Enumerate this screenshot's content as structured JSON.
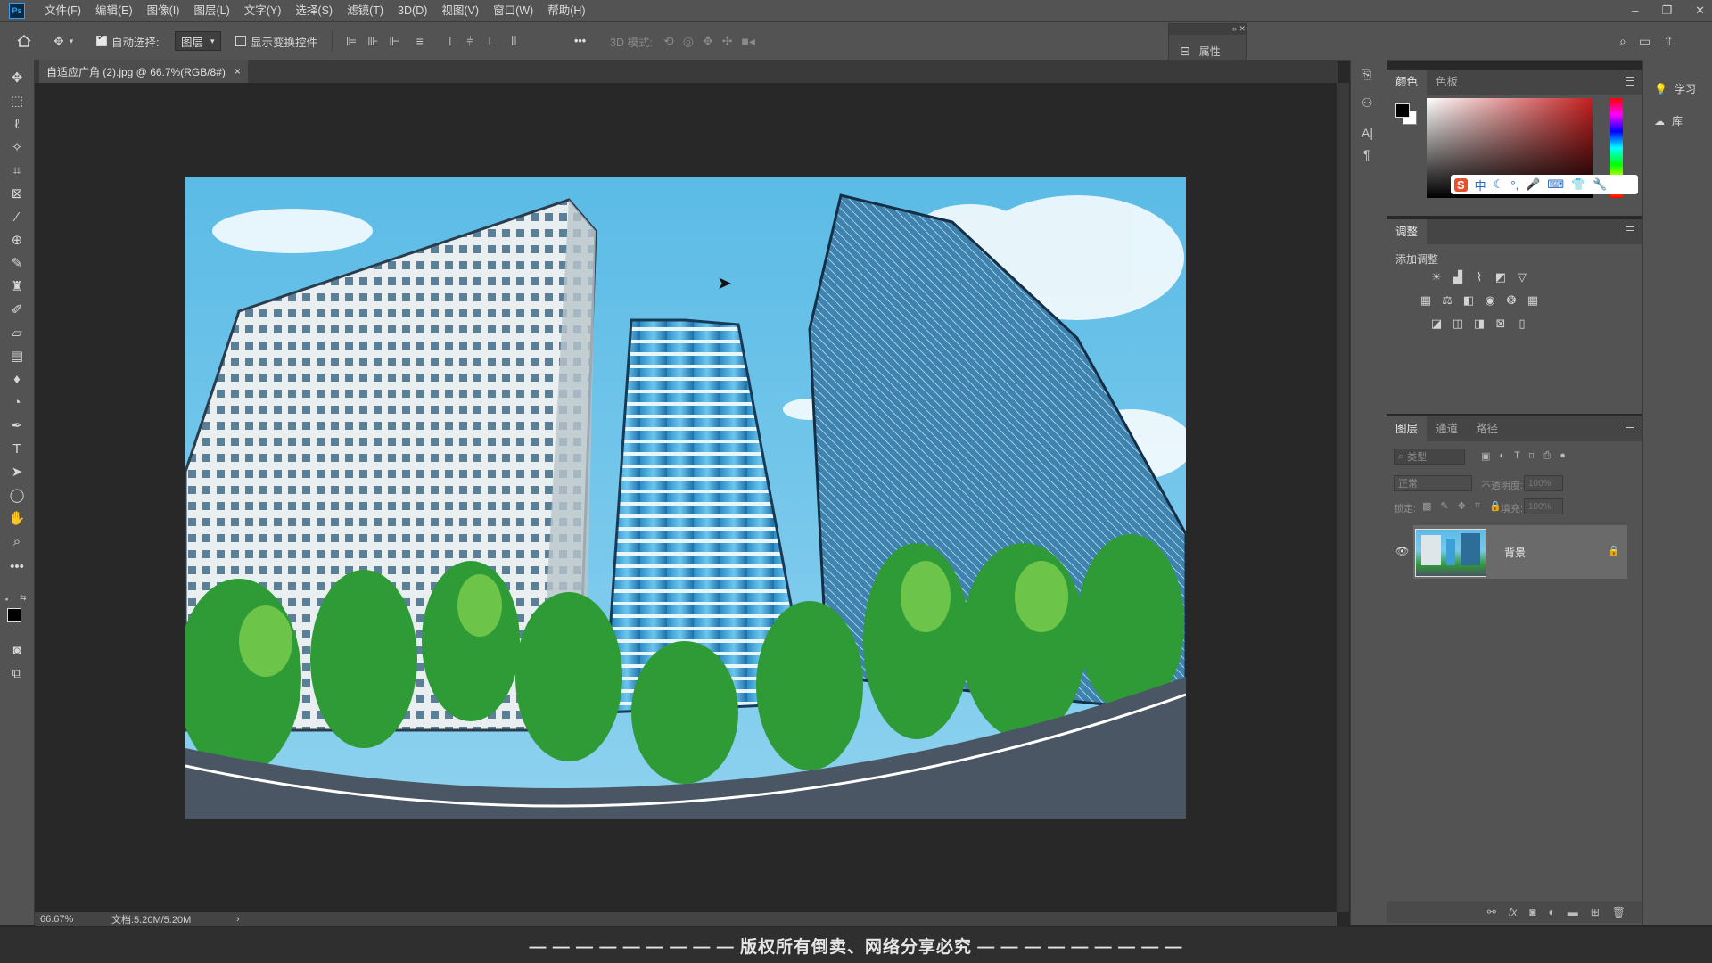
{
  "app": {
    "logo": "Ps"
  },
  "menu": [
    "文件(F)",
    "编辑(E)",
    "图像(I)",
    "图层(L)",
    "文字(Y)",
    "选择(S)",
    "滤镜(T)",
    "3D(D)",
    "视图(V)",
    "窗口(W)",
    "帮助(H)"
  ],
  "window_controls": {
    "minimize": "–",
    "restore": "❐",
    "close": "✕"
  },
  "options": {
    "auto_select_label": "自动选择:",
    "auto_select_checked": true,
    "layer_mode": "图层",
    "show_transform_label": "显示变换控件",
    "show_transform_checked": false,
    "mode_3d_label": "3D 模式:",
    "more": "•••"
  },
  "properties_panel": {
    "label": "属性"
  },
  "document_tab": {
    "title": "自适应广角 (2).jpg @ 66.7%(RGB/8#)",
    "close": "×"
  },
  "status": {
    "zoom": "66.67%",
    "doc_size": "文档:5.20M/5.20M",
    "arrow": "›"
  },
  "color_panel": {
    "tabs": [
      "颜色",
      "色板"
    ],
    "active": 0,
    "hue_color": "#c41f1f"
  },
  "ime_bar": {
    "items": [
      "S",
      "中",
      "☾",
      "°,",
      "🎤",
      "⌨",
      "👕",
      "🔧"
    ]
  },
  "adjustments_panel": {
    "title": "调整",
    "add_label": "添加调整"
  },
  "layers_panel": {
    "tabs": [
      "图层",
      "通道",
      "路径"
    ],
    "active": 0,
    "filter_placeholder": "类型",
    "blend_mode": "正常",
    "opacity_label": "不透明度:",
    "opacity_value": "100%",
    "lock_label": "锁定:",
    "fill_label": "填充:",
    "fill_value": "100%",
    "layers": [
      {
        "name": "背景",
        "visible": true,
        "locked": true
      }
    ]
  },
  "right_strip": {
    "learn_label": "学习",
    "libraries_label": "库"
  },
  "watermark": "— — — — — — — — — 版权所有倒卖、网络分享必究 — — — — — — — — —",
  "colors": {
    "accent": "#2fa3f7",
    "ui_gray": "#535353",
    "canvas_bg": "#282828"
  }
}
